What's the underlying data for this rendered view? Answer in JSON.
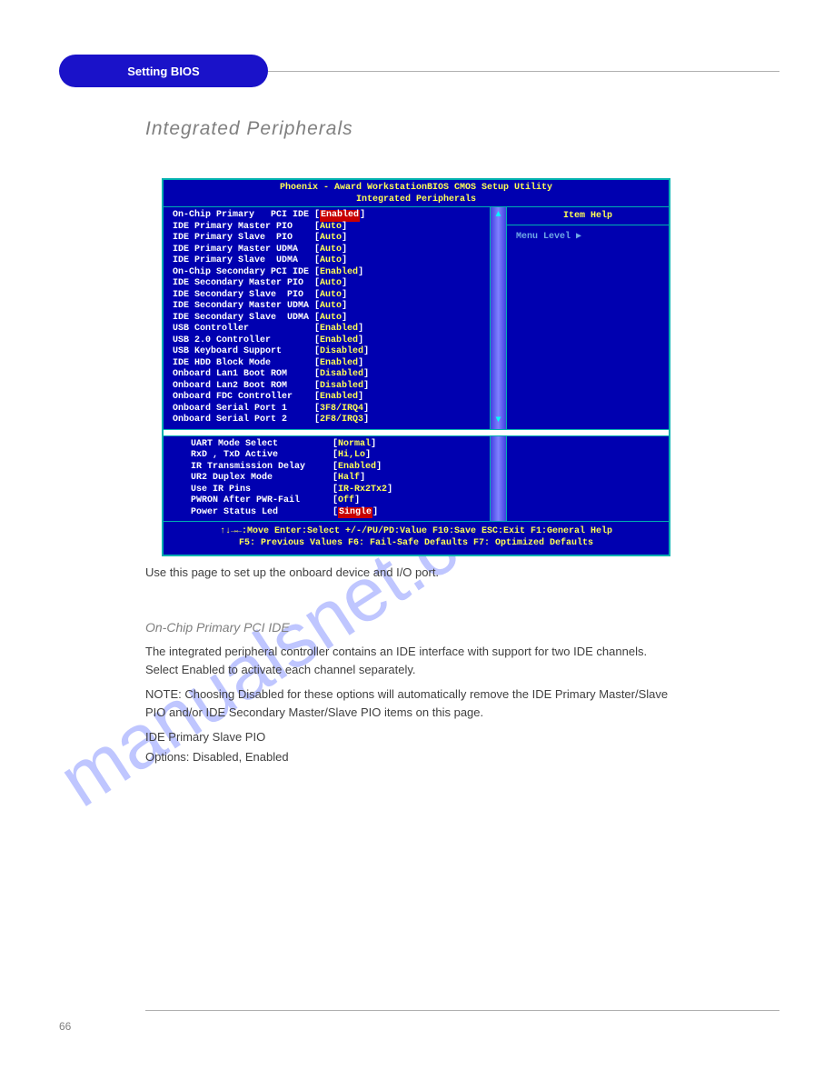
{
  "header": {
    "pill": "Setting BIOS",
    "section_title": "Integrated Peripherals"
  },
  "bios": {
    "title_line1": "Phoenix - Award WorkstationBIOS CMOS Setup Utility",
    "title_line2": "Integrated Peripherals",
    "help_title": "Item Help",
    "help_menu_level": "Menu Level   ▶",
    "items_top": [
      {
        "label": "On-Chip Primary   PCI IDE",
        "value": "Enabled",
        "style": "red"
      },
      {
        "label": "IDE Primary Master PIO   ",
        "value": "Auto",
        "style": "yellow"
      },
      {
        "label": "IDE Primary Slave  PIO   ",
        "value": "Auto",
        "style": "yellow"
      },
      {
        "label": "IDE Primary Master UDMA  ",
        "value": "Auto",
        "style": "yellow"
      },
      {
        "label": "IDE Primary Slave  UDMA  ",
        "value": "Auto",
        "style": "yellow"
      },
      {
        "label": "On-Chip Secondary PCI IDE",
        "value": "Enabled",
        "style": "yellow"
      },
      {
        "label": "IDE Secondary Master PIO ",
        "value": "Auto",
        "style": "yellow"
      },
      {
        "label": "IDE Secondary Slave  PIO ",
        "value": "Auto",
        "style": "yellow"
      },
      {
        "label": "IDE Secondary Master UDMA",
        "value": "Auto",
        "style": "yellow"
      },
      {
        "label": "IDE Secondary Slave  UDMA",
        "value": "Auto",
        "style": "yellow"
      },
      {
        "label": "USB Controller           ",
        "value": "Enabled",
        "style": "yellow"
      },
      {
        "label": "USB 2.0 Controller       ",
        "value": "Enabled",
        "style": "yellow"
      },
      {
        "label": "USB Keyboard Support     ",
        "value": "Disabled",
        "style": "yellow"
      },
      {
        "label": "IDE HDD Block Mode       ",
        "value": "Enabled",
        "style": "yellow"
      },
      {
        "label": "Onboard Lan1 Boot ROM    ",
        "value": "Disabled",
        "style": "yellow"
      },
      {
        "label": "Onboard Lan2 Boot ROM    ",
        "value": "Disabled",
        "style": "yellow"
      },
      {
        "label": "Onboard FDC Controller   ",
        "value": "Enabled",
        "style": "yellow"
      },
      {
        "label": "Onboard Serial Port 1    ",
        "value": "3F8/IRQ4",
        "style": "yellow"
      },
      {
        "label": "Onboard Serial Port 2    ",
        "value": "2F8/IRQ3",
        "style": "yellow"
      }
    ],
    "items_bottom": [
      {
        "label": "UART Mode Select         ",
        "value": "Normal",
        "style": "yellow"
      },
      {
        "label": "RxD , TxD Active         ",
        "value": "Hi,Lo",
        "style": "yellow"
      },
      {
        "label": "IR Transmission Delay    ",
        "value": "Enabled",
        "style": "yellow"
      },
      {
        "label": "UR2 Duplex Mode          ",
        "value": "Half",
        "style": "yellow"
      },
      {
        "label": "Use IR Pins              ",
        "value": "IR-Rx2Tx2",
        "style": "yellow"
      },
      {
        "label": "PWRON After PWR-Fail     ",
        "value": "Off",
        "style": "yellow"
      },
      {
        "label": "Power Status Led         ",
        "value": "Single",
        "style": "red"
      }
    ],
    "footer_line1": "↑↓→←:Move  Enter:Select  +/-/PU/PD:Value  F10:Save   ESC:Exit  F1:General Help",
    "footer_line2": "F5: Previous Values    F6: Fail-Safe Defaults     F7: Optimized Defaults"
  },
  "body": {
    "intro": "Use this page to set up the onboard device and I/O port.",
    "heading": "On-Chip Primary PCI IDE",
    "para1": "The integrated peripheral controller contains an IDE interface with support for two IDE channels. Select Enabled to activate each channel separately.",
    "para2": "NOTE: Choosing Disabled for these options will automatically remove the IDE Primary Master/Slave PIO and/or IDE Secondary Master/Slave PIO items on this page.",
    "para3": "IDE Primary Slave PIO",
    "opt": "Options: Disabled, Enabled"
  },
  "watermark": "manualsnet.com",
  "page_number": "66"
}
